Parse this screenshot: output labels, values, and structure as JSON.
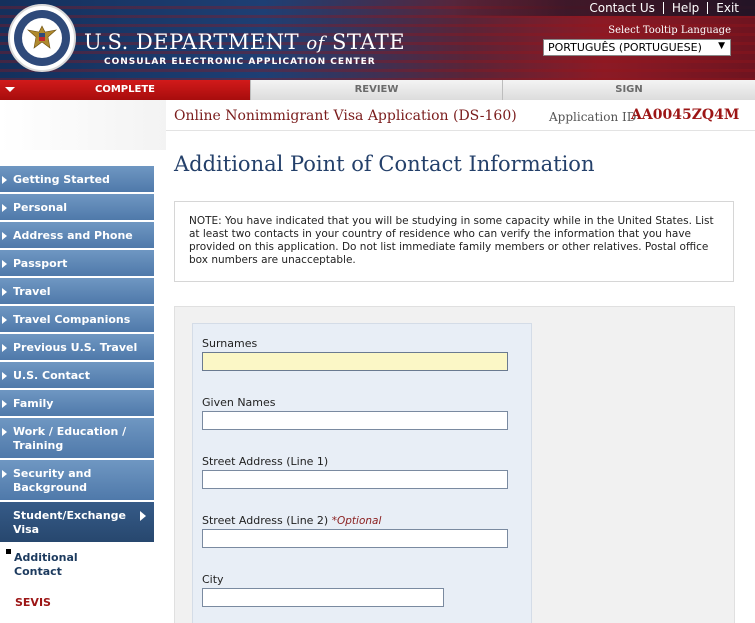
{
  "header": {
    "top_links": [
      "Contact Us",
      "Help",
      "Exit"
    ],
    "title_prefix": "U.S. Department",
    "title_of": "of",
    "title_suffix": "State",
    "subtitle": "CONSULAR ELECTRONIC APPLICATION CENTER",
    "tooltip_language_label": "Select Tooltip Language",
    "tooltip_language_value": "PORTUGUÊS (PORTUGUESE)",
    "seal_icon": "department-of-state-seal"
  },
  "tabs": [
    {
      "label": "COMPLETE",
      "active": true
    },
    {
      "label": "REVIEW",
      "active": false
    },
    {
      "label": "SIGN",
      "active": false
    }
  ],
  "application": {
    "form_title": "Online Nonimmigrant Visa Application (DS-160)",
    "id_label": "Application ID",
    "id_value": "AA0045ZQ4M"
  },
  "sidebar": {
    "items": [
      {
        "label": "Getting Started"
      },
      {
        "label": "Personal"
      },
      {
        "label": "Address and Phone"
      },
      {
        "label": "Passport"
      },
      {
        "label": "Travel"
      },
      {
        "label": "Travel Companions"
      },
      {
        "label": "Previous U.S. Travel"
      },
      {
        "label": "U.S. Contact"
      },
      {
        "label": "Family"
      },
      {
        "label": "Work / Education / Training"
      },
      {
        "label": "Security and Background"
      },
      {
        "label": "Student/Exchange Visa"
      }
    ],
    "subitems": [
      {
        "label": "Additional Contact"
      },
      {
        "label": "SEVIS"
      }
    ]
  },
  "main": {
    "page_title": "Additional Point of Contact Information",
    "note": "NOTE: You have indicated that you will be studying in some capacity while in the United States. List at least two contacts in your country of residence who can verify the information that you have provided on this application. Do not list immediate family members or other relatives. Postal office box numbers are unacceptable.",
    "fields": [
      {
        "label": "Surnames",
        "value": ""
      },
      {
        "label": "Given Names",
        "value": ""
      },
      {
        "label": "Street Address (Line 1)",
        "value": ""
      },
      {
        "label": "Street Address (Line 2)",
        "optional": "*Optional",
        "value": ""
      },
      {
        "label": "City",
        "value": ""
      }
    ]
  },
  "colors": {
    "header_blue": "#1e3f74",
    "header_red": "#8c1a25",
    "active_tab_red": "#c11414",
    "nav_blue": "#5b84b3",
    "title_blue": "#24406a",
    "app_id_red": "#9c1515",
    "focused_field": "#fbf7c6"
  }
}
